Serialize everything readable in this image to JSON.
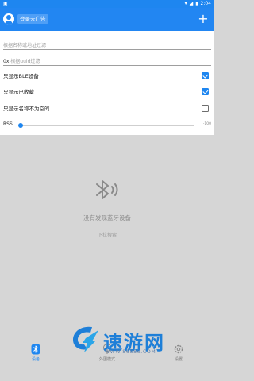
{
  "status_bar": {
    "time": "2:04"
  },
  "app_bar": {
    "login_label": "登录去广告",
    "add_symbol": "+"
  },
  "filters": {
    "name_filter_placeholder": "根据名称或地址过滤",
    "uuid_prefix": "0x",
    "uuid_filter_placeholder": "根据uuid过滤",
    "options": [
      {
        "label": "只显示BLE设备",
        "checked": true
      },
      {
        "label": "只显示已收藏",
        "checked": true
      },
      {
        "label": "只显示名称不为空的",
        "checked": false
      }
    ],
    "rssi": {
      "label": "RSSI",
      "value": "-100",
      "level": 0.0
    }
  },
  "empty_state": {
    "title": "没有发现蓝牙设备",
    "hint": "下拉搜索"
  },
  "watermark": {
    "text": "速游网",
    "url": "WWW.86886.COM"
  },
  "bottom_nav": [
    {
      "label": "设备",
      "active": true,
      "icon": "bluetooth-icon"
    },
    {
      "label": "外围模式",
      "active": false,
      "icon": "broadcast-icon"
    },
    {
      "label": "设置",
      "active": false,
      "icon": "gear-icon"
    }
  ],
  "colors": {
    "primary": "#2286f2",
    "background": "#d6d6d6"
  }
}
